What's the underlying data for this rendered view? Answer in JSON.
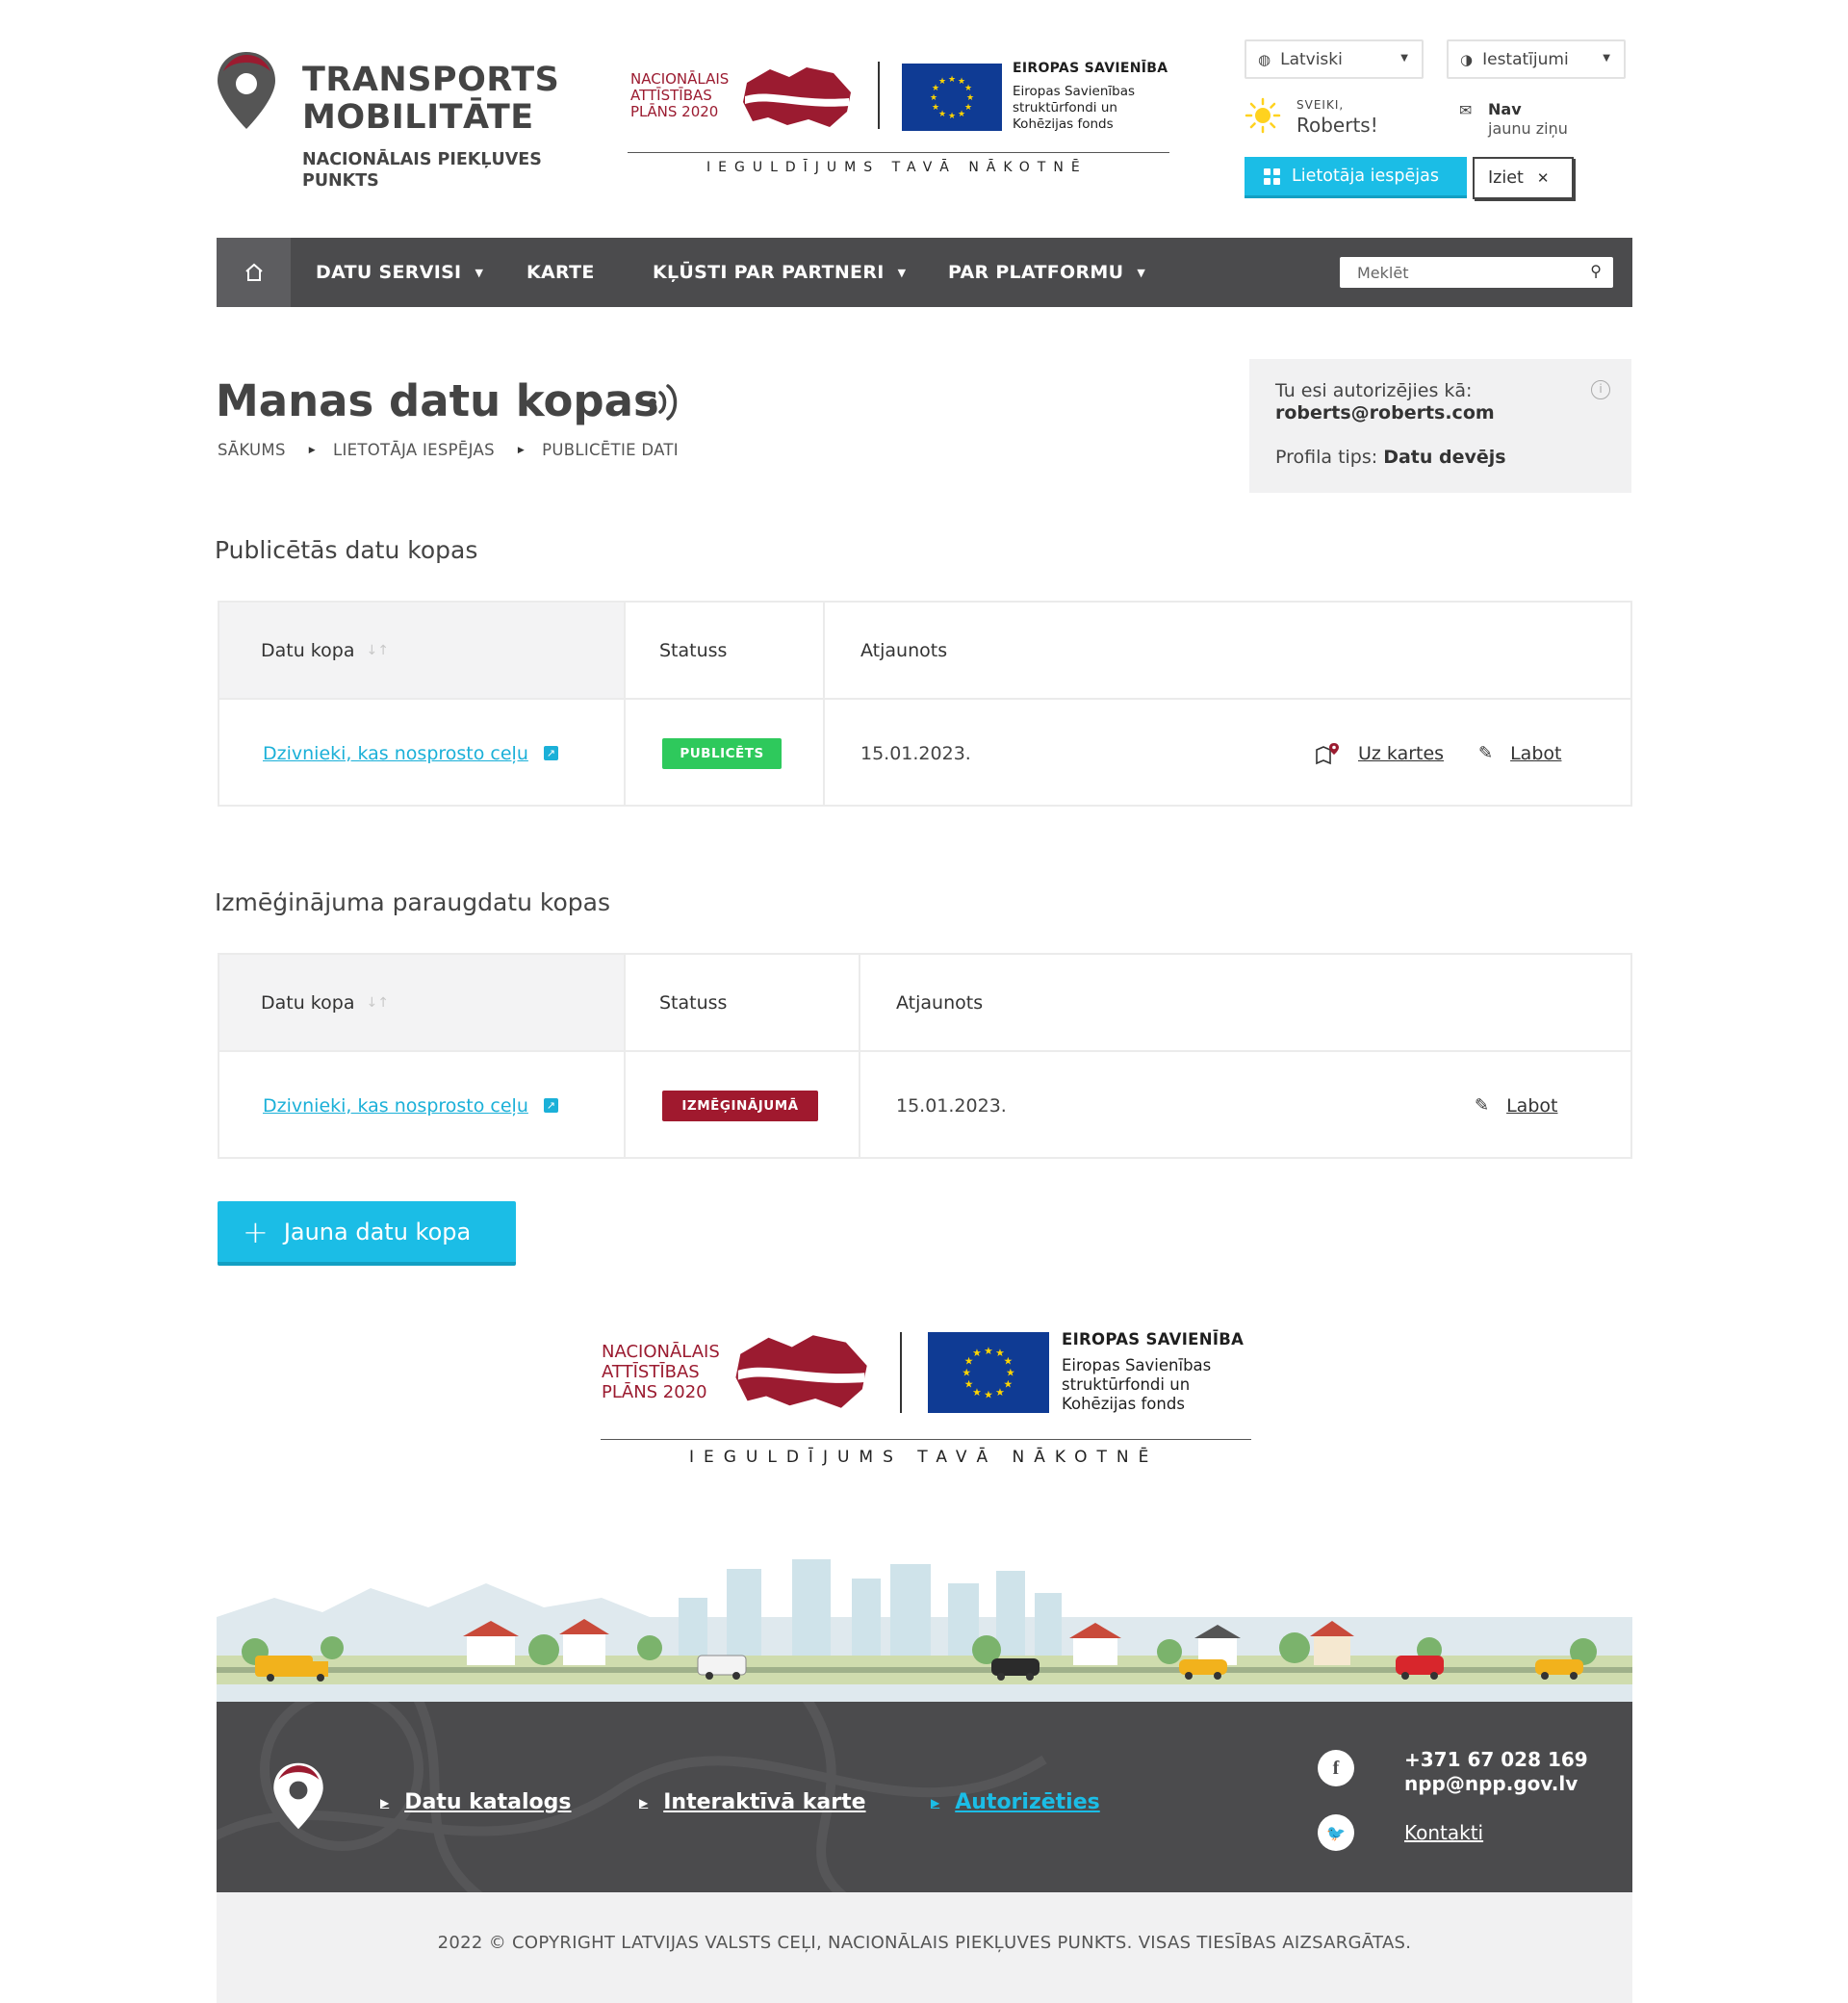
{
  "brand": {
    "title_line1": "TRANSPORTS",
    "title_line2": "MOBILITĀTE",
    "subtitle_line1": "NACIONĀLAIS PIEKĻUVES",
    "subtitle_line2": "PUNKTS"
  },
  "eu_logo": {
    "nap_line1": "NACIONĀLAIS",
    "nap_line2": "ATTĪSTĪBAS",
    "nap_line3": "PLĀNS 2020",
    "eu_title": "EIROPAS SAVIENĪBA",
    "eu_line1": "Eiropas Savienības",
    "eu_line2": "struktūrfondi un",
    "eu_line3": "Kohēzijas fonds",
    "slogan": "IEGULDĪJUMS TAVĀ NĀKOTNĒ"
  },
  "header": {
    "language": "Latviski",
    "settings": "Iestatījumi",
    "greeting": "SVEIKI,",
    "user_name": "Roberts!",
    "messages_title": "Nav",
    "messages_sub": "jaunu ziņu",
    "user_options_button": "Lietotāja iespējas",
    "logout_button": "Iziet"
  },
  "nav": {
    "items": [
      "DATU SERVISI",
      "KARTE",
      "KĻŪSTI PAR PARTNERI",
      "PAR PLATFORMU"
    ],
    "search_placeholder": "Meklēt"
  },
  "page": {
    "title": "Manas datu kopas",
    "breadcrumb": [
      "SĀKUMS",
      "LIETOTĀJA IESPĒJAS",
      "PUBLICĒTIE DATI"
    ]
  },
  "auth_box": {
    "label": "Tu esi autorizējies kā:",
    "email": "roberts@roberts.com",
    "profile_label": "Profila tips:",
    "profile_value": "Datu devējs"
  },
  "published": {
    "section_title": "Publicētās datu kopas",
    "headers": [
      "Datu kopa",
      "Statuss",
      "Atjaunots"
    ],
    "rows": [
      {
        "dataset": "Dzivnieki, kas nosprosto ceļu",
        "status": "PUBLICĒTS",
        "updated": "15.01.2023.",
        "action_map": "Uz kartes",
        "action_edit": "Labot"
      }
    ]
  },
  "trial": {
    "section_title": "Izmēģinājuma paraugdatu kopas",
    "headers": [
      "Datu kopa",
      "Statuss",
      "Atjaunots"
    ],
    "rows": [
      {
        "dataset": "Dzivnieki, kas nosprosto ceļu",
        "status": "IZMĒĢINĀJUMĀ",
        "updated": "15.01.2023.",
        "action_edit": "Labot"
      }
    ]
  },
  "new_dataset_button": "Jauna datu kopa",
  "footer": {
    "links": [
      "Datu katalogs",
      "Interaktīvā karte",
      "Autorizēties"
    ],
    "phone": "+371 67 028 169",
    "email": "npp@npp.gov.lv",
    "contacts": "Kontakti",
    "copyright": "2022 © COPYRIGHT LATVIJAS VALSTS CEĻI, NACIONĀLAIS PIEKĻUVES PUNKTS. VISAS TIESĪBAS AIZSARGĀTAS."
  },
  "colors": {
    "accent": "#1bbde6",
    "nav_bg": "#4b4b4d",
    "published_badge": "#2ec95c",
    "trial_badge": "#a0192e",
    "brand_red": "#9b1b30"
  }
}
